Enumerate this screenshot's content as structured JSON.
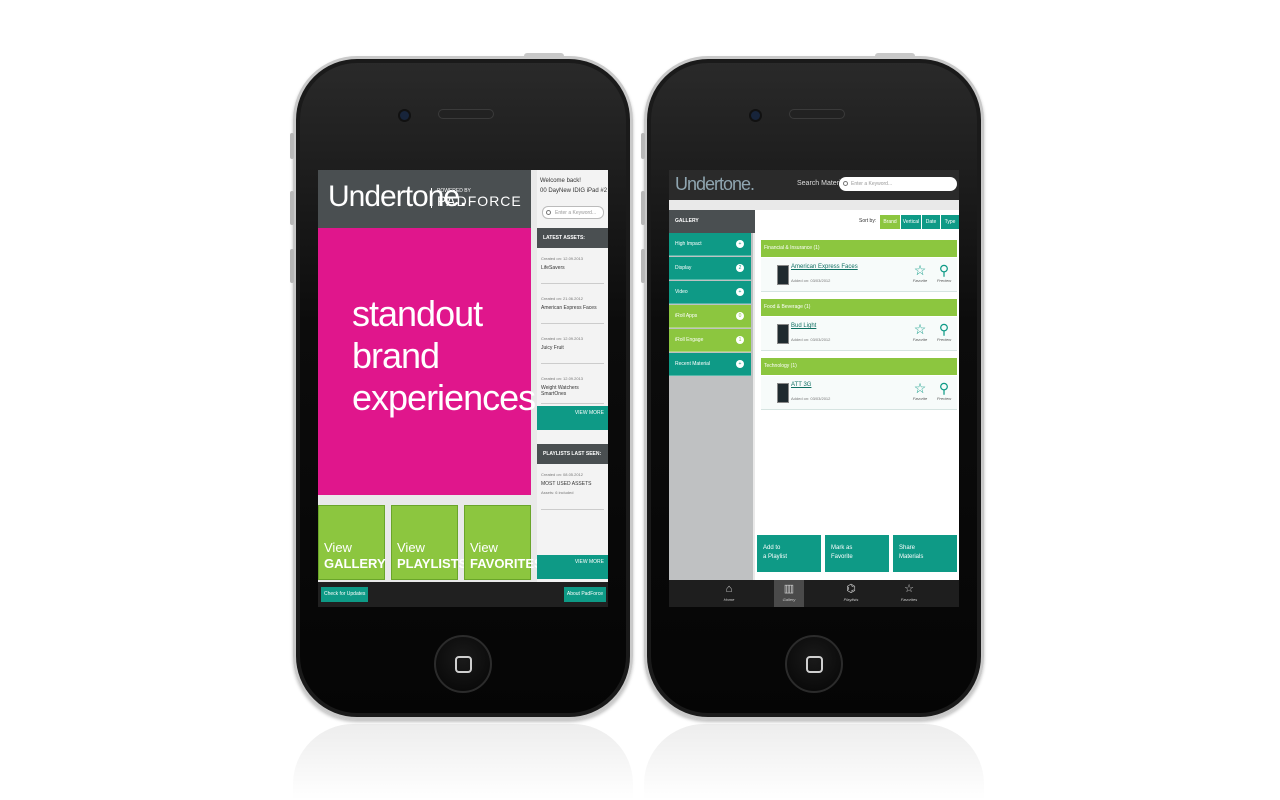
{
  "left_app": {
    "logo": "Undertone.",
    "powered_by": "POWERED BY",
    "padforce": "PADFORCE",
    "hero_text": "standout brand experiences.",
    "tiles": [
      {
        "line1": "View",
        "line2": "GALLERY"
      },
      {
        "line1": "View",
        "line2": "PLAYLISTS"
      },
      {
        "line1": "View",
        "line2": "FAVORITES"
      }
    ],
    "welcome_line1": "Welcome back!",
    "welcome_line2": "00 DayNew IDIG iPad #2",
    "search_placeholder": "Enter a Keyword...",
    "latest_assets_title": "LATEST ASSETS:",
    "latest_assets": [
      {
        "date": "Created on: 12.09.2013",
        "name": "LifeSavers"
      },
      {
        "date": "Created on: 21.06.2012",
        "name": "American Express Faces"
      },
      {
        "date": "Created on: 12.09.2013",
        "name": "Juicy Fruit"
      },
      {
        "date": "Created on: 12.09.2013",
        "name": "Weight Watchers SmartOnes"
      }
    ],
    "view_more": "VIEW MORE",
    "playlists_title": "PLAYLISTS LAST SEEN:",
    "playlist": {
      "date": "Created on: 08.05.2012",
      "name": "MOST USED ASSETS",
      "meta": "Assets: 6 included"
    },
    "check_updates": "Check for Updates",
    "about": "About PadForce"
  },
  "right_app": {
    "logo": "Undertone.",
    "search_label": "Search Material:",
    "search_placeholder": "Enter a Keyword...",
    "gallery_title": "GALLERY",
    "nav_items": [
      {
        "label": "High Impact",
        "count": "+"
      },
      {
        "label": "Display",
        "count": "2"
      },
      {
        "label": "Video",
        "count": "+"
      },
      {
        "label": "iRoll Apps",
        "count": "0"
      },
      {
        "label": "iRoll Engage",
        "count": "1"
      },
      {
        "label": "Recent Material",
        "count": "+"
      }
    ],
    "sort_label": "Sort by:",
    "sort_options": [
      "Brand",
      "Vertical",
      "Date",
      "Type"
    ],
    "categories": [
      {
        "title": "Financial & Insurance (1)",
        "item": "American Express Faces",
        "added": "Added on: 03/03/2012"
      },
      {
        "title": "Food & Beverage (1)",
        "item": "Bud Light",
        "added": "Added on: 03/03/2012"
      },
      {
        "title": "Technology (1)",
        "item": "ATT 3G",
        "added": "Added on: 03/03/2012"
      }
    ],
    "favorite_label": "Favorite",
    "preview_label": "Preview",
    "actions": [
      {
        "line1": "Add to",
        "line2": "a Playlist"
      },
      {
        "line1": "Mark as",
        "line2": "Favorite"
      },
      {
        "line1": "Share",
        "line2": "Materials"
      }
    ],
    "tabs": [
      "Home",
      "Gallery",
      "Playlists",
      "Favorites"
    ]
  }
}
